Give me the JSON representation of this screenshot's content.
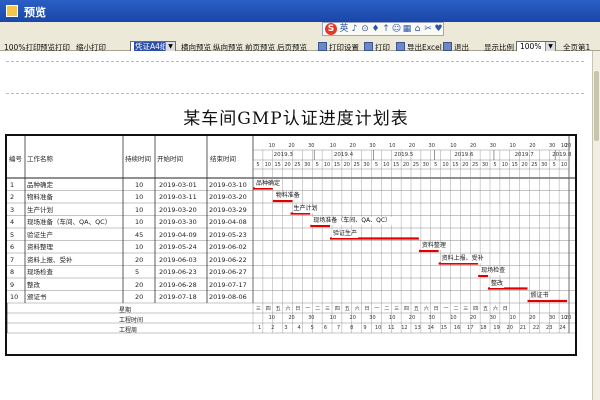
{
  "window": {
    "title": "预览"
  },
  "toolbar": {
    "buttons": [
      "100%打印",
      "预览打印",
      "缩小打印"
    ],
    "paper_select": "凭证A4纸",
    "mid_buttons": [
      "横向预览",
      "纵向预览",
      "前页预览",
      "后页预览"
    ],
    "right_buttons": [
      "打印设置",
      "打印",
      "导出Excel",
      "退出"
    ],
    "scale_label": "显示比例",
    "scale_value": "100%",
    "page_info": "全页第1"
  },
  "float_toolbar": {
    "brand": "S",
    "icons": [
      "英",
      "♪",
      "⊙",
      "♦",
      "↑",
      "☺",
      "▦",
      "⌂",
      "✂",
      "♥"
    ]
  },
  "document": {
    "title": "某车间GMP认证进度计划表",
    "columns": [
      "编号",
      "工作名称",
      "持续时间",
      "开始时间",
      "结束时间"
    ],
    "months": [
      "2019.3",
      "2019.4",
      "2019.5",
      "2019.6",
      "2019.7",
      "2019.8"
    ],
    "day_ticks": [
      "10",
      "20",
      "30",
      "10",
      "20",
      "30",
      "10",
      "20",
      "30",
      "10",
      "20",
      "30",
      "10",
      "20",
      "30",
      "10",
      "20"
    ],
    "tasks": [
      {
        "no": "1",
        "name": "品种确定",
        "duration": "10",
        "start": "2019-03-01",
        "end": "2019-03-10",
        "bar": "品种确定",
        "bar_start": 0,
        "bar_end": 10
      },
      {
        "no": "2",
        "name": "物料准备",
        "duration": "10",
        "start": "2019-03-11",
        "end": "2019-03-20",
        "bar": "物料准备",
        "bar_start": 10,
        "bar_end": 20
      },
      {
        "no": "3",
        "name": "生产计划",
        "duration": "10",
        "start": "2019-03-20",
        "end": "2019-03-29",
        "bar": "生产计划",
        "bar_start": 19,
        "bar_end": 29
      },
      {
        "no": "4",
        "name": "现场准备（车间、QA、QC）",
        "duration": "10",
        "start": "2019-03-30",
        "end": "2019-04-08",
        "bar": "现场准备（车间、QA、QC）",
        "bar_start": 29,
        "bar_end": 39
      },
      {
        "no": "5",
        "name": "验证生产",
        "duration": "45",
        "start": "2019-04-09",
        "end": "2019-05-23",
        "bar": "验证生产",
        "bar_start": 39,
        "bar_end": 84
      },
      {
        "no": "6",
        "name": "资料整理",
        "duration": "10",
        "start": "2019-05-24",
        "end": "2019-06-02",
        "bar": "资料整理",
        "bar_start": 84,
        "bar_end": 94
      },
      {
        "no": "7",
        "name": "资料上报、受补",
        "duration": "20",
        "start": "2019-06-03",
        "end": "2019-06-22",
        "bar": "资料上报、受补",
        "bar_start": 94,
        "bar_end": 114
      },
      {
        "no": "8",
        "name": "现场检查",
        "duration": "5",
        "start": "2019-06-23",
        "end": "2019-06-27",
        "bar": "现场检查",
        "bar_start": 114,
        "bar_end": 119
      },
      {
        "no": "9",
        "name": "整改",
        "duration": "20",
        "start": "2019-06-28",
        "end": "2019-07-17",
        "bar": "整改",
        "bar_start": 119,
        "bar_end": 139
      },
      {
        "no": "10",
        "name": "颁证书",
        "duration": "20",
        "start": "2019-07-18",
        "end": "2019-08-06",
        "bar": "颁证书",
        "bar_start": 139,
        "bar_end": 159
      }
    ],
    "footer_rows": [
      "星期",
      "工程时间",
      "工程周"
    ],
    "weekdays": [
      "三",
      "四",
      "五",
      "六",
      "日",
      "一",
      "二",
      "三",
      "四",
      "五",
      "六",
      "日",
      "一",
      "二",
      "三",
      "四",
      "五",
      "六",
      "日",
      "一",
      "二",
      "三",
      "四",
      "五",
      "六",
      "日"
    ],
    "footer_day_ticks": [
      "10",
      "20",
      "30",
      "10",
      "20",
      "30",
      "10",
      "20",
      "30",
      "10",
      "20",
      "30",
      "10",
      "20",
      "30",
      "10",
      "20"
    ],
    "week_numbers": [
      "1",
      "2",
      "3",
      "4",
      "5",
      "6",
      "7",
      "8",
      "9",
      "10",
      "11",
      "12",
      "13",
      "14",
      "15",
      "16",
      "17",
      "18",
      "19",
      "20",
      "21",
      "22",
      "23",
      "24"
    ],
    "span_days": 160
  },
  "colors": {
    "bar": "#e00000",
    "grid": "#8a8a8a",
    "frame": "#111111"
  }
}
